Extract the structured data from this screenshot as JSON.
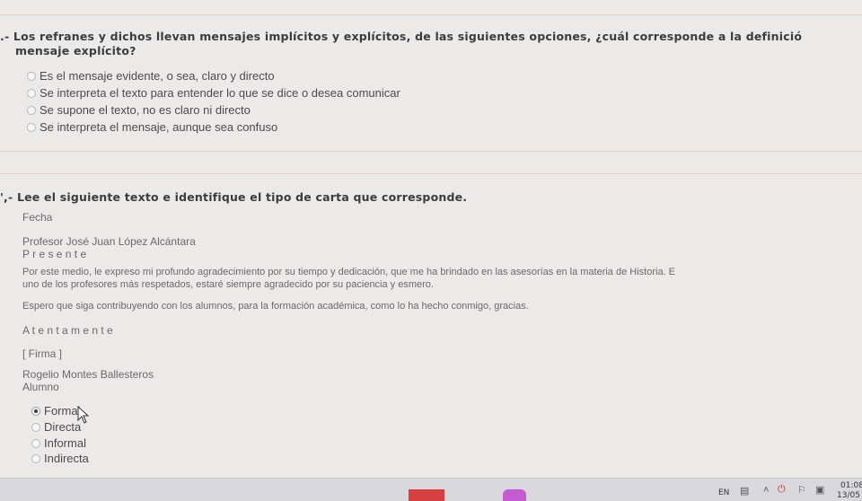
{
  "q1": {
    "prefix": ".-",
    "line1": "Los refranes y dichos llevan mensajes implícitos y explícitos, de las siguientes opciones, ¿cuál corresponde a la definició",
    "line2": "mensaje explícito?",
    "options": [
      {
        "label": "Es el mensaje evidente, o sea, claro y directo",
        "selected": false
      },
      {
        "label": "Se interpreta el texto para entender lo que se dice o desea comunicar",
        "selected": false
      },
      {
        "label": "Se supone el texto, no es claro ni directo",
        "selected": false
      },
      {
        "label": "Se interpreta el mensaje, aunque sea confuso",
        "selected": false
      }
    ]
  },
  "q2": {
    "prefix": "',-",
    "title": "Lee el siguiente texto e identifique el tipo de carta que corresponde.",
    "letter": {
      "date": "Fecha",
      "recipient": "Profesor José Juan López Alcántara",
      "presente": "P r e s e n t e",
      "body1_line1": "Por este medio, le expreso mi profundo agradecimiento por su tiempo y dedicación, que me ha brindado en las asesorías en la materia de Historia. E",
      "body1_line2": "uno de los profesores más respetados, estaré siempre agradecido por su paciencia y esmero.",
      "body2": "Espero que siga contribuyendo con los alumnos, para la formación académica, como lo ha hecho conmigo, gracias.",
      "closing": "A t e n t a m e n t e",
      "signature": "[ Firma ]",
      "sender_name": "Rogelio Montes Ballesteros",
      "sender_role": "Alumno"
    },
    "options": [
      {
        "label": "Formal",
        "selected": true
      },
      {
        "label": "Directa",
        "selected": false
      },
      {
        "label": "Informal",
        "selected": false
      },
      {
        "label": "Indirecta",
        "selected": false
      }
    ]
  },
  "taskbar": {
    "language": "EN",
    "time": "01:08",
    "date": "13/05"
  }
}
